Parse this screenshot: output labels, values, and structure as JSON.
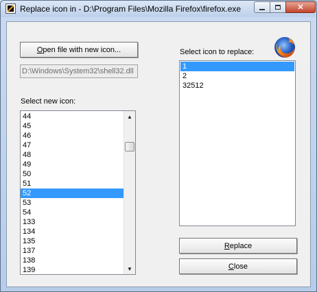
{
  "window": {
    "title": "Replace icon in - D:\\Program Files\\Mozilla Firefox\\firefox.exe",
    "minimize_icon": "minimize-icon",
    "maximize_icon": "maximize-icon",
    "close_icon": "close-icon"
  },
  "left": {
    "open_button": {
      "accel": "O",
      "rest": "pen file with new icon..."
    },
    "path_value": "D:\\Windows\\System32\\shell32.dll",
    "select_label": {
      "pre": "Select ",
      "accel": "n",
      "post": "ew icon:"
    },
    "icons": [
      "44",
      "45",
      "46",
      "47",
      "48",
      "49",
      "50",
      "51",
      "52",
      "53",
      "54",
      "133",
      "134",
      "135",
      "137",
      "138",
      "139"
    ],
    "selected": "52"
  },
  "right": {
    "select_label": {
      "pre": "Select icon to repl",
      "accel": "a",
      "post": "ce:"
    },
    "icons": [
      "1",
      "2",
      "32512"
    ],
    "selected": "1",
    "replace_button": {
      "accel": "R",
      "rest": "eplace"
    },
    "close_button": {
      "accel": "C",
      "rest": "lose"
    }
  },
  "icons": {
    "app": "resource-hacker-icon",
    "firefox": "firefox-logo-icon",
    "scroll_up": "scroll-up-arrow-icon",
    "scroll_down": "scroll-down-arrow-icon"
  },
  "colors": {
    "selection": "#3399ff",
    "titlebar": "#bdd0ea",
    "close_button": "#c4432c"
  }
}
